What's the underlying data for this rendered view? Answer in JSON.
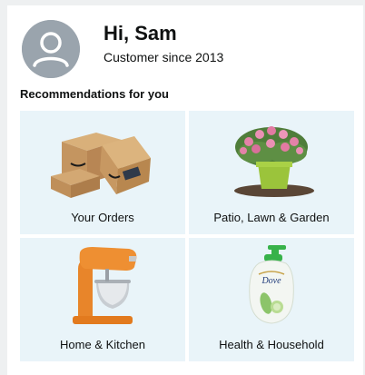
{
  "profile": {
    "greeting": "Hi, Sam",
    "subtitle": "Customer since 2013",
    "avatar_icon": "user-avatar-icon"
  },
  "recommendations": {
    "title": "Recommendations for you",
    "tiles": [
      {
        "label": "Your Orders",
        "icon": "boxes-icon"
      },
      {
        "label": "Patio, Lawn & Garden",
        "icon": "potted-plant-icon"
      },
      {
        "label": "Home & Kitchen",
        "icon": "stand-mixer-icon"
      },
      {
        "label": "Health & Household",
        "icon": "body-wash-bottle-icon"
      }
    ]
  },
  "colors": {
    "page_background": "#eef0f1",
    "card_background": "#ffffff",
    "tile_background": "#e9f4f9",
    "avatar_background": "#9aa4ad",
    "text": "#0f1111"
  }
}
